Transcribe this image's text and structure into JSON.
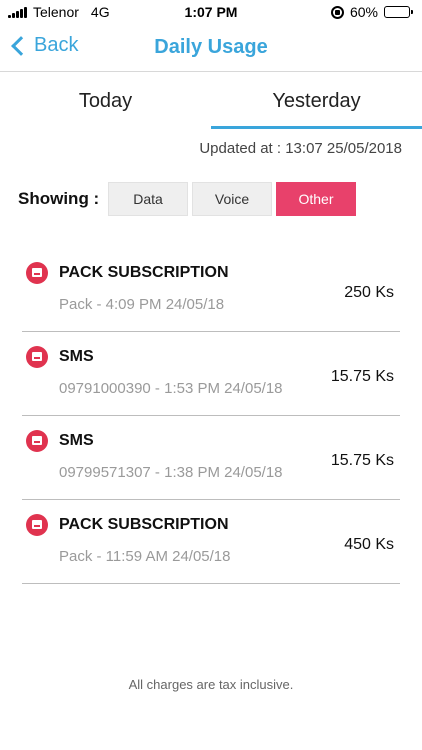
{
  "status_bar": {
    "carrier": "Telenor",
    "network": "4G",
    "time": "1:07 PM",
    "battery_percent": "60%",
    "battery_level": 0.6
  },
  "nav": {
    "back_label": "Back",
    "title": "Daily Usage"
  },
  "tabs": [
    {
      "label": "Today",
      "active": false
    },
    {
      "label": "Yesterday",
      "active": true
    }
  ],
  "updated_text": "Updated at : 13:07 25/05/2018",
  "filter": {
    "label": "Showing :",
    "options": [
      {
        "label": "Data",
        "active": false
      },
      {
        "label": "Voice",
        "active": false
      },
      {
        "label": "Other",
        "active": true
      }
    ]
  },
  "items": [
    {
      "title": "PACK SUBSCRIPTION",
      "subtitle": "Pack  - 4:09 PM 24/05/18",
      "amount": "250 Ks",
      "icon": "sim-card-icon"
    },
    {
      "title": "SMS",
      "subtitle": "09791000390 - 1:53 PM 24/05/18",
      "amount": "15.75 Ks",
      "icon": "sim-card-icon"
    },
    {
      "title": "SMS",
      "subtitle": "09799571307 - 1:38 PM 24/05/18",
      "amount": "15.75 Ks",
      "icon": "sim-card-icon"
    },
    {
      "title": "PACK SUBSCRIPTION",
      "subtitle": "Pack  - 11:59 AM 24/05/18",
      "amount": "450 Ks",
      "icon": "sim-card-icon"
    }
  ],
  "footer_note": "All charges are tax inclusive.",
  "colors": {
    "accent": "#3aa5db",
    "active_filter": "#e8416b",
    "item_icon": "#e0334f"
  }
}
